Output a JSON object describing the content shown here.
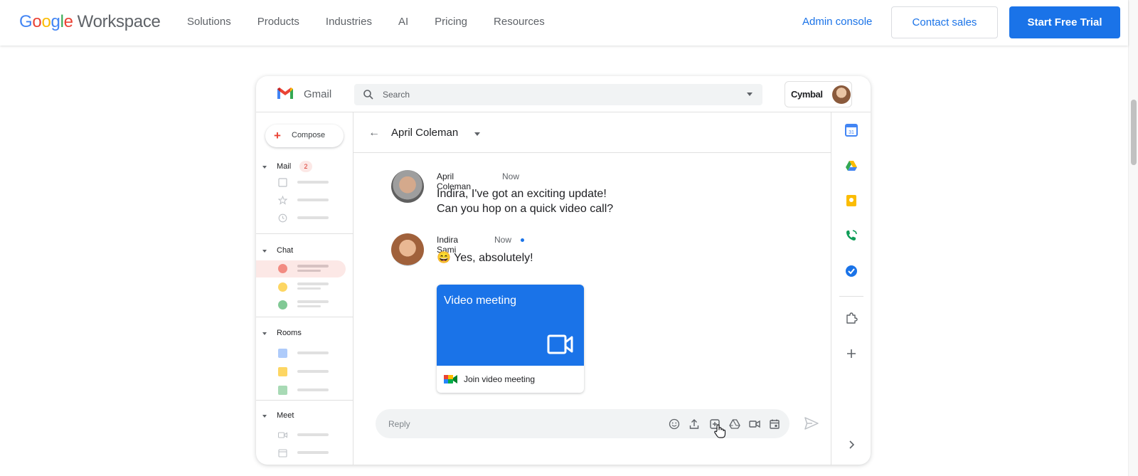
{
  "nav": {
    "logo_google": [
      "G",
      "o",
      "o",
      "g",
      "l",
      "e"
    ],
    "logo_workspace": "Workspace",
    "links": [
      "Solutions",
      "Products",
      "Industries",
      "AI",
      "Pricing",
      "Resources"
    ],
    "admin_console": "Admin console",
    "contact_sales": "Contact sales",
    "start_trial": "Start Free Trial"
  },
  "gmail": {
    "app_name": "Gmail",
    "search_placeholder": "Search",
    "brand": "Cymbal",
    "compose": "Compose",
    "sidebar": {
      "mail": "Mail",
      "mail_badge": "2",
      "chat": "Chat",
      "rooms": "Rooms",
      "meet": "Meet"
    },
    "conversation": {
      "title": "April Coleman",
      "messages": [
        {
          "sender": "April Coleman",
          "time": "Now",
          "lines": [
            "Indira, I've got an exciting update!",
            "Can you hop on a quick video call?"
          ]
        },
        {
          "sender": "Indira Sami",
          "time": "Now",
          "emoji": "😄",
          "lines": [
            "Yes, absolutely!"
          ]
        }
      ],
      "video_card": {
        "title": "Video meeting",
        "join": "Join video meeting"
      },
      "reply_placeholder": "Reply"
    },
    "right_rail_icons": [
      "calendar-icon",
      "drive-icon",
      "keep-icon",
      "voice-icon",
      "tasks-icon",
      "addons-icon",
      "add-icon",
      "chevron-right-icon"
    ]
  },
  "colors": {
    "accent": "#1a73e8",
    "selected_chat": "#fce8e6"
  }
}
